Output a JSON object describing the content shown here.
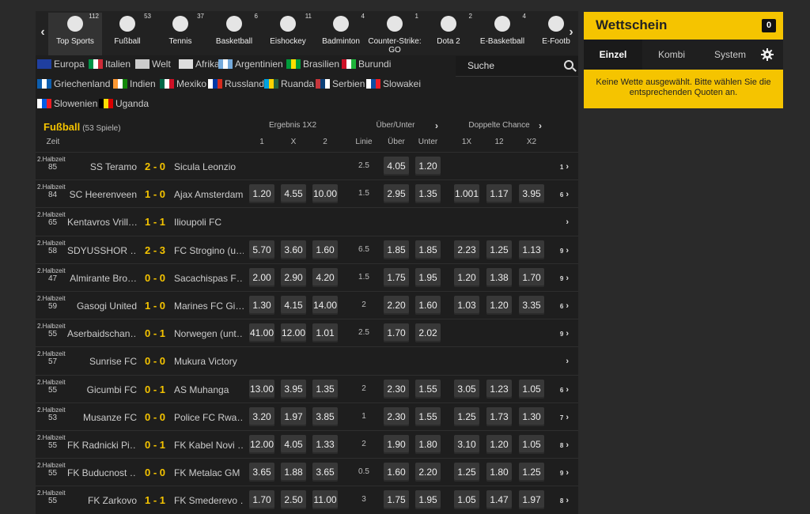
{
  "sports": [
    {
      "label": "Top Sports",
      "count": "112",
      "icon": "top-sports-icon"
    },
    {
      "label": "Fußball",
      "count": "53",
      "icon": "soccer-ball-icon"
    },
    {
      "label": "Tennis",
      "count": "37",
      "icon": "tennis-ball-icon"
    },
    {
      "label": "Basketball",
      "count": "6",
      "icon": "basketball-icon"
    },
    {
      "label": "Eishockey",
      "count": "11",
      "icon": "hockey-puck-icon"
    },
    {
      "label": "Badminton",
      "count": "4",
      "icon": "shuttlecock-icon"
    },
    {
      "label": "Counter-Strike: GO",
      "count": "1",
      "icon": "counter-strike-icon"
    },
    {
      "label": "Dota 2",
      "count": "2",
      "icon": "dota-icon"
    },
    {
      "label": "E-Basketball",
      "count": "4",
      "icon": "e-basketball-icon"
    },
    {
      "label": "E-Footb",
      "count": "",
      "icon": "e-football-icon"
    }
  ],
  "countries": [
    {
      "name": "Europa",
      "flag": [
        "#1f3fa0",
        "#1f3fa0",
        "#1f3fa0"
      ]
    },
    {
      "name": "Italien",
      "flag": [
        "#009246",
        "#ffffff",
        "#ce2b37"
      ]
    },
    {
      "name": "Welt",
      "flag": [
        "#cccccc",
        "#cccccc",
        "#cccccc"
      ]
    },
    {
      "name": "Afrika",
      "flag": [
        "#dddddd",
        "#dddddd",
        "#dddddd"
      ]
    },
    {
      "name": "Argentinien",
      "flag": [
        "#75aadb",
        "#ffffff",
        "#75aadb"
      ]
    },
    {
      "name": "Brasilien",
      "flag": [
        "#009c3b",
        "#ffdf00",
        "#009c3b"
      ]
    },
    {
      "name": "Burundi",
      "flag": [
        "#ce1126",
        "#ffffff",
        "#1eb53a"
      ]
    },
    {
      "name": "Griechenland",
      "flag": [
        "#0d5eaf",
        "#ffffff",
        "#0d5eaf"
      ]
    },
    {
      "name": "Indien",
      "flag": [
        "#ff9933",
        "#ffffff",
        "#138808"
      ]
    },
    {
      "name": "Mexiko",
      "flag": [
        "#006847",
        "#ffffff",
        "#ce1126"
      ]
    },
    {
      "name": "Russland",
      "flag": [
        "#ffffff",
        "#0039a6",
        "#d52b1e"
      ]
    },
    {
      "name": "Ruanda",
      "flag": [
        "#00a1de",
        "#fad201",
        "#20603d"
      ]
    },
    {
      "name": "Serbien",
      "flag": [
        "#c6363c",
        "#0c4076",
        "#ffffff"
      ]
    },
    {
      "name": "Slowakei",
      "flag": [
        "#ffffff",
        "#0b4ea2",
        "#ee1c25"
      ]
    },
    {
      "name": "Slowenien",
      "flag": [
        "#ffffff",
        "#005ce5",
        "#ed1c24"
      ]
    },
    {
      "name": "Uganda",
      "flag": [
        "#000000",
        "#fcdc04",
        "#d90000"
      ]
    }
  ],
  "search": {
    "placeholder": "Suche"
  },
  "section": {
    "title": "Fußball",
    "subtitle": "(53 Spiele)"
  },
  "headers": {
    "result": "Ergebnis 1X2",
    "overunder": "Über/Unter",
    "double": "Doppelte Chance",
    "time": "Zeit",
    "c1": "1",
    "cx": "X",
    "c2": "2",
    "line": "Linie",
    "over": "Über",
    "under": "Unter",
    "d1x": "1X",
    "d12": "12",
    "dx2": "X2"
  },
  "matches": [
    {
      "period": "2.Halbzeit",
      "minute": "85",
      "home": "SS Teramo",
      "score": "2 - 0",
      "away": "Sicula Leonzio",
      "o1": "",
      "ox": "",
      "o2": "",
      "line": "2.5",
      "over": "4.05",
      "under": "1.20",
      "d1x": "",
      "d12": "",
      "dx2": "",
      "more": "1"
    },
    {
      "period": "2.Halbzeit",
      "minute": "84",
      "home": "SC Heerenveen",
      "score": "1 - 0",
      "away": "Ajax Amsterdam",
      "o1": "1.20",
      "ox": "4.55",
      "o2": "10.00",
      "line": "1.5",
      "over": "2.95",
      "under": "1.35",
      "d1x": "1.001",
      "d12": "1.17",
      "dx2": "3.95",
      "more": "6"
    },
    {
      "period": "2.Halbzeit",
      "minute": "65",
      "home": "Kentavros Vrill…",
      "score": "1 - 1",
      "away": "Ilioupoli FC",
      "o1": "",
      "ox": "",
      "o2": "",
      "line": "",
      "over": "",
      "under": "",
      "d1x": "",
      "d12": "",
      "dx2": "",
      "more": ""
    },
    {
      "period": "2.Halbzeit",
      "minute": "58",
      "home": "SDYUSSHOR …",
      "score": "2 - 3",
      "away": "FC Strogino (u…",
      "o1": "5.70",
      "ox": "3.60",
      "o2": "1.60",
      "line": "6.5",
      "over": "1.85",
      "under": "1.85",
      "d1x": "2.23",
      "d12": "1.25",
      "dx2": "1.13",
      "more": "9"
    },
    {
      "period": "2.Halbzeit",
      "minute": "47",
      "home": "Almirante Bro…",
      "score": "0 - 0",
      "away": "Sacachispas F…",
      "o1": "2.00",
      "ox": "2.90",
      "o2": "4.20",
      "line": "1.5",
      "over": "1.75",
      "under": "1.95",
      "d1x": "1.20",
      "d12": "1.38",
      "dx2": "1.70",
      "more": "9"
    },
    {
      "period": "2.Halbzeit",
      "minute": "59",
      "home": "Gasogi United",
      "score": "1 - 0",
      "away": "Marines FC Gi…",
      "o1": "1.30",
      "ox": "4.15",
      "o2": "14.00",
      "line": "2",
      "over": "2.20",
      "under": "1.60",
      "d1x": "1.03",
      "d12": "1.20",
      "dx2": "3.35",
      "more": "6"
    },
    {
      "period": "2.Halbzeit",
      "minute": "55",
      "home": "Aserbaidschan…",
      "score": "0 - 1",
      "away": "Norwegen (unt…",
      "o1": "41.00",
      "ox": "12.00",
      "o2": "1.01",
      "line": "2.5",
      "over": "1.70",
      "under": "2.02",
      "d1x": "",
      "d12": "",
      "dx2": "",
      "more": "9"
    },
    {
      "period": "2.Halbzeit",
      "minute": "57",
      "home": "Sunrise FC",
      "score": "0 - 0",
      "away": "Mukura Victory",
      "o1": "",
      "ox": "",
      "o2": "",
      "line": "",
      "over": "",
      "under": "",
      "d1x": "",
      "d12": "",
      "dx2": "",
      "more": ""
    },
    {
      "period": "2.Halbzeit",
      "minute": "55",
      "home": "Gicumbi FC",
      "score": "0 - 1",
      "away": "AS Muhanga",
      "o1": "13.00",
      "ox": "3.95",
      "o2": "1.35",
      "line": "2",
      "over": "2.30",
      "under": "1.55",
      "d1x": "3.05",
      "d12": "1.23",
      "dx2": "1.05",
      "more": "6"
    },
    {
      "period": "2.Halbzeit",
      "minute": "53",
      "home": "Musanze FC",
      "score": "0 - 0",
      "away": "Police FC Rwa…",
      "o1": "3.20",
      "ox": "1.97",
      "o2": "3.85",
      "line": "1",
      "over": "2.30",
      "under": "1.55",
      "d1x": "1.25",
      "d12": "1.73",
      "dx2": "1.30",
      "more": "7"
    },
    {
      "period": "2.Halbzeit",
      "minute": "55",
      "home": "FK Radnicki Pi…",
      "score": "0 - 1",
      "away": "FK Kabel Novi …",
      "o1": "12.00",
      "ox": "4.05",
      "o2": "1.33",
      "line": "2",
      "over": "1.90",
      "under": "1.80",
      "d1x": "3.10",
      "d12": "1.20",
      "dx2": "1.05",
      "more": "8"
    },
    {
      "period": "2.Halbzeit",
      "minute": "55",
      "home": "FK Buducnost …",
      "score": "0 - 0",
      "away": "FK Metalac GM",
      "o1": "3.65",
      "ox": "1.88",
      "o2": "3.65",
      "line": "0.5",
      "over": "1.60",
      "under": "2.20",
      "d1x": "1.25",
      "d12": "1.80",
      "dx2": "1.25",
      "more": "9"
    },
    {
      "period": "2.Halbzeit",
      "minute": "55",
      "home": "FK Zarkovo",
      "score": "1 - 1",
      "away": "FK Smederevo …",
      "o1": "1.70",
      "ox": "2.50",
      "o2": "11.00",
      "line": "3",
      "over": "1.75",
      "under": "1.95",
      "d1x": "1.05",
      "d12": "1.47",
      "dx2": "1.97",
      "more": "8"
    }
  ],
  "betslip": {
    "title": "Wettschein",
    "count": "0",
    "tabs": [
      "Einzel",
      "Kombi",
      "System"
    ],
    "message": "Keine Wette ausgewählt. Bitte wählen Sie die entsprechenden Quoten an."
  },
  "colors": {
    "accent": "#f5c400",
    "background": "#2a2a2a",
    "panel": "#1e1e1e",
    "odd_button": "#383838"
  }
}
